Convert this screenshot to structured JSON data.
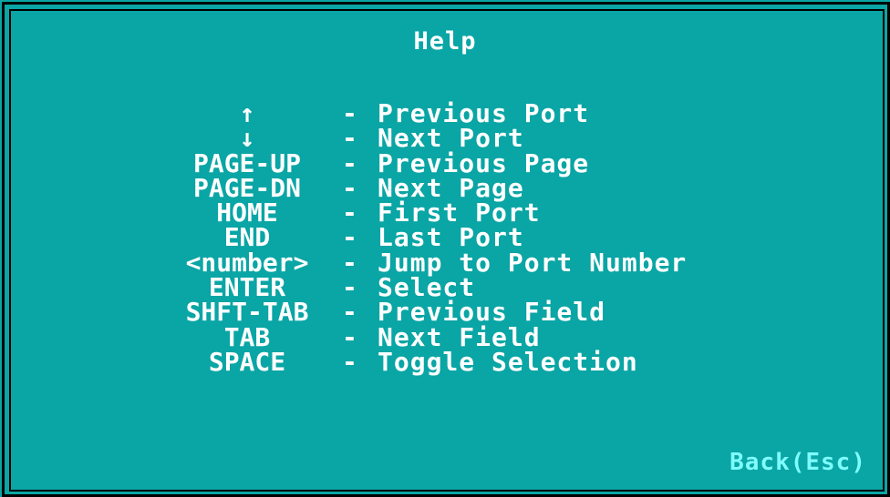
{
  "title": "Help",
  "keys": [
    {
      "key": "↑",
      "sep": "-",
      "desc": "Previous Port"
    },
    {
      "key": "↓",
      "sep": "-",
      "desc": "Next Port"
    },
    {
      "key": "PAGE-UP",
      "sep": "-",
      "desc": "Previous Page"
    },
    {
      "key": "PAGE-DN",
      "sep": "-",
      "desc": "Next Page"
    },
    {
      "key": "HOME",
      "sep": "-",
      "desc": "First Port"
    },
    {
      "key": "END",
      "sep": "-",
      "desc": "Last Port"
    },
    {
      "key": "<number>",
      "sep": "-",
      "desc": "Jump to Port Number"
    },
    {
      "key": "ENTER",
      "sep": "-",
      "desc": "Select"
    },
    {
      "key": "SHFT-TAB",
      "sep": "-",
      "desc": "Previous Field"
    },
    {
      "key": "TAB",
      "sep": "-",
      "desc": "Next Field"
    },
    {
      "key": "SPACE",
      "sep": "-",
      "desc": "Toggle Selection"
    }
  ],
  "back_label": "Back(Esc)",
  "colors": {
    "background": "#0aa5a5",
    "text": "#ffffff",
    "back_text": "#7ffcfc",
    "frame": "#000000"
  }
}
